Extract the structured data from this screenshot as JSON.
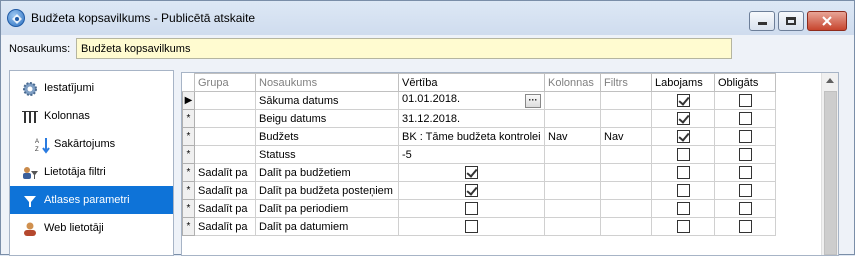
{
  "window": {
    "title": "Budžeta kopsavilkums - Publicētā atskaite",
    "controls": [
      "minimize-icon",
      "maximize-icon",
      "close-icon"
    ]
  },
  "name_field": {
    "label": "Nosaukums:",
    "value": "Budžeta kopsavilkums"
  },
  "sidebar": {
    "items": [
      {
        "label": "Iestatījumi",
        "icon": "gear-icon",
        "active": false
      },
      {
        "label": "Kolonnas",
        "icon": "columns-icon",
        "active": false
      },
      {
        "label": "Sakārtojums",
        "icon": "sort-icon",
        "active": false
      },
      {
        "label": "Lietotāja filtri",
        "icon": "filter-user-icon",
        "active": false
      },
      {
        "label": "Atlases parametri",
        "icon": "funnel-icon",
        "active": true
      },
      {
        "label": "Web lietotāji",
        "icon": "web-user-icon",
        "active": false
      }
    ]
  },
  "grid": {
    "columns": [
      "Grupa",
      "Nosaukums",
      "Vērtība",
      "Kolonnas",
      "Filtrs",
      "Labojams",
      "Obligāts"
    ],
    "rows": [
      {
        "marker": "▶",
        "grupa": "",
        "nosaukums": "Sākuma datums",
        "vertiba": "01.01.2018.",
        "vertiba_checkbox": null,
        "has_ellipsis": true,
        "kolonnas": "",
        "filtrs": "",
        "labojams": true,
        "obligats": false
      },
      {
        "marker": "*",
        "grupa": "",
        "nosaukums": "Beigu datums",
        "vertiba": "31.12.2018.",
        "vertiba_checkbox": null,
        "has_ellipsis": false,
        "kolonnas": "",
        "filtrs": "",
        "labojams": true,
        "obligats": false
      },
      {
        "marker": "*",
        "grupa": "",
        "nosaukums": "Budžets",
        "vertiba": "BK : Tāme budžeta kontrolei",
        "vertiba_checkbox": null,
        "has_ellipsis": false,
        "kolonnas": "Nav",
        "filtrs": "Nav",
        "labojams": true,
        "obligats": false
      },
      {
        "marker": "*",
        "grupa": "",
        "nosaukums": "Statuss",
        "vertiba": "-5",
        "vertiba_checkbox": null,
        "has_ellipsis": false,
        "kolonnas": "",
        "filtrs": "",
        "labojams": false,
        "obligats": false
      },
      {
        "marker": "*",
        "grupa": "Sadalīt pa",
        "nosaukums": "Dalīt pa budžetiem",
        "vertiba": "",
        "vertiba_checkbox": true,
        "has_ellipsis": false,
        "kolonnas": "",
        "filtrs": "",
        "labojams": false,
        "obligats": false
      },
      {
        "marker": "*",
        "grupa": "Sadalīt pa",
        "nosaukums": "Dalīt pa budžeta posteņiem",
        "vertiba": "",
        "vertiba_checkbox": true,
        "has_ellipsis": false,
        "kolonnas": "",
        "filtrs": "",
        "labojams": false,
        "obligats": false
      },
      {
        "marker": "*",
        "grupa": "Sadalīt pa",
        "nosaukums": "Dalīt pa periodiem",
        "vertiba": "",
        "vertiba_checkbox": false,
        "has_ellipsis": false,
        "kolonnas": "",
        "filtrs": "",
        "labojams": false,
        "obligats": false
      },
      {
        "marker": "*",
        "grupa": "Sadalīt pa",
        "nosaukums": "Dalīt pa datumiem",
        "vertiba": "",
        "vertiba_checkbox": false,
        "has_ellipsis": false,
        "kolonnas": "",
        "filtrs": "",
        "labojams": false,
        "obligats": false
      }
    ]
  },
  "colors": {
    "active_nav": "#0e73d8",
    "name_input_bg": "#fffbd0",
    "close_button": "#c7452e"
  }
}
